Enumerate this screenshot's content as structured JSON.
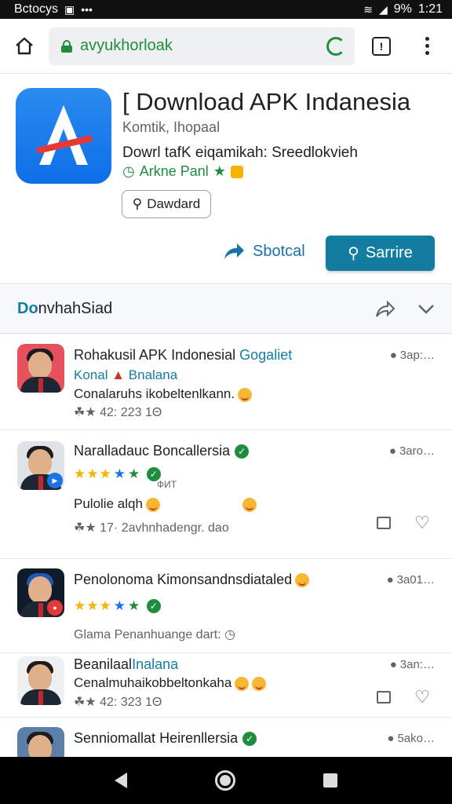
{
  "status_bar": {
    "left_text": "Bctocys",
    "time": "1:21",
    "battery": "9%"
  },
  "browser": {
    "url": "avyukhorloak"
  },
  "app": {
    "title": "[ Download APK Indanesia",
    "developer": "Komtik, Ihopaal",
    "description": "Dowrl tafK eiqamikah: Sreedlokvieh",
    "tags": "Arkne Panl",
    "small_button": "Dawdard",
    "share_label": "Sbotcal",
    "primary_button": "Sarrire"
  },
  "section": {
    "title_prefix": "Do",
    "title_rest": "nvhahSiad"
  },
  "items": [
    {
      "title": "Rohakusil APK Indonesial",
      "title_accent": "Gogaliet",
      "line1": "Konal",
      "line1b": "Bnalana",
      "line2": "Conalaruhs ikobeltenlkann.",
      "meta": "☘★ 42: 223 1Θ",
      "time": "3ap:…"
    },
    {
      "title": "Naralladauc Boncallersia",
      "stars_note": "ФИТ",
      "line2": "Pulolie alqh",
      "meta": "☘★ 17· 2avhnhadengr. dao",
      "time": "3aro…"
    },
    {
      "title": "Penolonoma Kimonsandnsdiataled",
      "meta": "Glama Penanhuange dart:",
      "time": "3a01…"
    },
    {
      "title": "Beanilaal",
      "title_accent": "Inalana",
      "line2": "Cenalmuhaikobbeltonkaha",
      "meta": "☘★ 42: 323 1Θ",
      "time": "3an:…"
    },
    {
      "title": "Senniomallat Heirenllersia",
      "time": "5ako…"
    }
  ]
}
